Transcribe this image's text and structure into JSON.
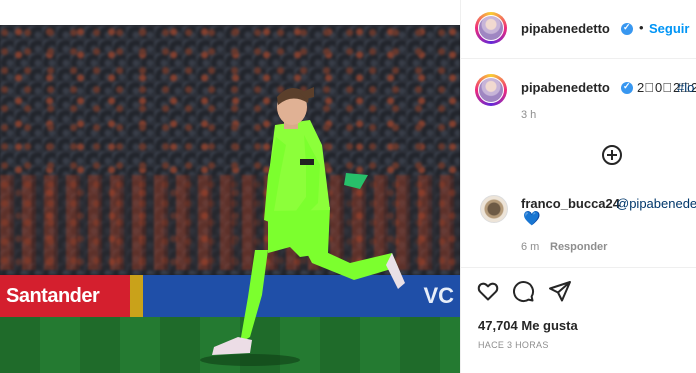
{
  "post": {
    "image_alt": "",
    "board_left": "Santander",
    "board_right": "VC"
  },
  "header": {
    "username": "pipabenedetto",
    "separator": "•",
    "follow_label": "Seguir"
  },
  "caption": {
    "username": "pipabenedetto",
    "text": "2⃣0⃣2⃣2⃣",
    "hashtag": "#lo",
    "time": "3 h"
  },
  "comments": [
    {
      "username": "franco_bucca24",
      "mention": "@pipabenedet",
      "emoji": "💙",
      "time": "6 m",
      "reply_label": "Responder"
    }
  ],
  "actions": {
    "likes": "47,704 Me gusta",
    "posted": "HACE 3 HORAS"
  },
  "icons": {
    "verified": "verified-badge-icon",
    "load_more": "plus-circle-icon",
    "like": "heart-icon",
    "comment": "comment-icon",
    "share": "share-icon"
  },
  "colors": {
    "accent": "#0095f6",
    "verified": "#3897f0",
    "kit": "#7cff2e"
  }
}
